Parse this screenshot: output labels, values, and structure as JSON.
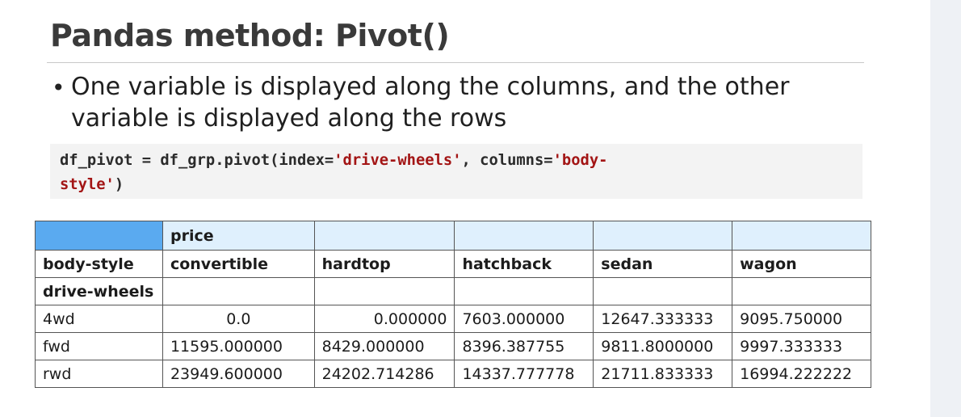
{
  "slide": {
    "title": "Pandas method: Pivot()",
    "bullet": "One variable is displayed along the columns, and the other variable is displayed along the rows",
    "code": {
      "line1_pre": "df_pivot = df_grp.pivot(index=",
      "line1_str1": "'drive-wheels'",
      "line1_mid": ", columns=",
      "line1_str2": "'body-",
      "line2_str": "style'",
      "line2_post": ")"
    }
  },
  "table": {
    "top_header": "price",
    "column_index_label": "body-style",
    "row_index_label": "drive-wheels",
    "columns": [
      "convertible",
      "hardtop",
      "hatchback",
      "sedan",
      "wagon"
    ],
    "rows": [
      {
        "label": "4wd",
        "values": [
          "0.0",
          "0.000000",
          "7603.000000",
          "12647.333333",
          "9095.750000"
        ]
      },
      {
        "label": "fwd",
        "values": [
          "11595.000000",
          "8429.000000",
          "8396.387755",
          "9811.8000000",
          "9997.333333"
        ]
      },
      {
        "label": "rwd",
        "values": [
          "23949.600000",
          "24202.714286",
          "14337.777778",
          "21711.833333",
          "16994.222222"
        ]
      }
    ]
  }
}
